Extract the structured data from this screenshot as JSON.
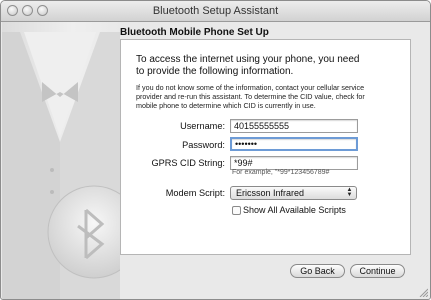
{
  "window": {
    "title": "Bluetooth Setup Assistant"
  },
  "page": {
    "heading": "Bluetooth Mobile Phone Set Up",
    "intro": "To access the internet using your phone, you need to provide the following information.",
    "note": "If you do not know some of the information, contact your cellular service provider and re-run this assistant. To determine the CID value, check for mobile phone to determine which CID is currently in use."
  },
  "form": {
    "username_label": "Username:",
    "username_value": "40155555555",
    "password_label": "Password:",
    "password_value": "•••••••",
    "cid_label": "GPRS CID String:",
    "cid_value": "*99#",
    "cid_example": "For example, \"*99*123456789#",
    "modem_label": "Modem Script:",
    "modem_value": "Ericsson Infrared",
    "show_all_label": "Show All Available Scripts"
  },
  "buttons": {
    "back": "Go Back",
    "continue": "Continue"
  }
}
